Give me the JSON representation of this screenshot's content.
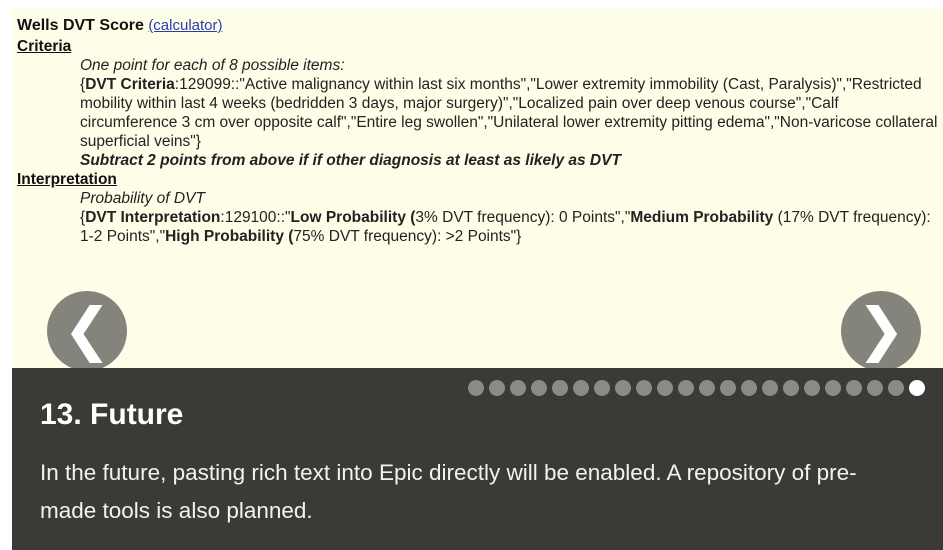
{
  "document": {
    "title": "Wells DVT Score",
    "calculator_link": "(calculator)",
    "criteria_heading": "Criteria",
    "criteria_intro": "One point for each of 8 possible items:",
    "criteria_label": "DVT Criteria",
    "criteria_text": ":129099::\"Active malignancy within last six months\",\"Lower extremity immobility (Cast, Paralysis)\",\"Restricted mobility within last 4 weeks (bedridden 3 days, major surgery)\",\"Localized pain over deep venous course\",\"Calf circumference 3 cm over opposite calf\",\"Entire leg swollen\",\"Unilateral lower extremity pitting edema\",\"Non-varicose collateral superficial veins\"}",
    "subtract_note": "Subtract 2 points from above if if other diagnosis at least as likely as DVT",
    "interpretation_heading": "Interpretation",
    "interpretation_intro": "Probability of DVT",
    "interpretation_label": "DVT Interpretation",
    "interp_code": ":129100::\"",
    "low_label": "Low Probability (",
    "low_text": "3% DVT frequency): 0 Points\",\"",
    "medium_label": "Medium Probability",
    "medium_text": " (17% DVT frequency): 1-2 Points\",\"",
    "high_label": "High Probability (",
    "high_text": "75% DVT frequency): >2 Points\"}"
  },
  "navigation": {
    "prev_glyph": "❮",
    "next_glyph": "❯",
    "total_slides": 22,
    "active_slide": 22
  },
  "caption": {
    "title": "13. Future",
    "text": "In the future, pasting rich text into Epic directly will be enabled. A repository of pre-made tools is also planned."
  }
}
